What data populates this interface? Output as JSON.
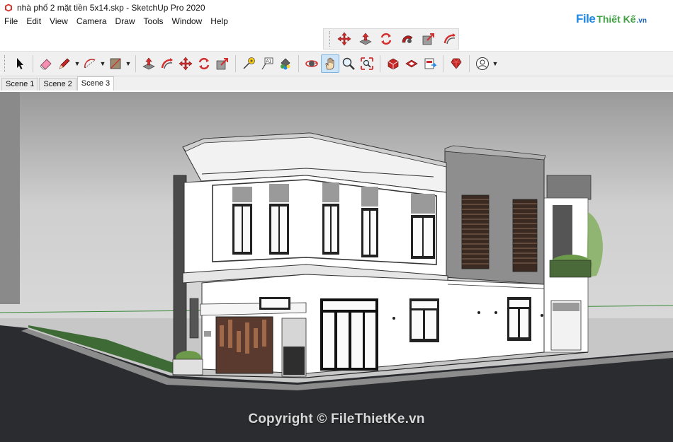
{
  "window": {
    "title": "nhà phố 2 mặt tiền 5x14.skp - SketchUp Pro 2020",
    "app_icon": "sketchup-icon"
  },
  "menu": [
    "File",
    "Edit",
    "View",
    "Camera",
    "Draw",
    "Tools",
    "Window",
    "Help"
  ],
  "logo": {
    "file": "File",
    "rest": "Thiết Kế",
    "vn": ".vn"
  },
  "float_toolbar": {
    "icons": [
      "move-icon",
      "push-pull-icon",
      "rotate-icon",
      "follow-me-icon",
      "scale-icon",
      "offset-icon"
    ]
  },
  "toolbar": {
    "icons": [
      "select-icon",
      "eraser-icon",
      "pencil-icon",
      "arc-icon",
      "rectangle-icon",
      "push-pull-icon",
      "offset-icon",
      "move-icon",
      "rotate-icon",
      "scale-icon",
      "tape-measure-icon",
      "text-icon",
      "paint-bucket-icon",
      "orbit-icon",
      "pan-icon",
      "zoom-icon",
      "zoom-extents-icon",
      "3d-warehouse-icon",
      "extension-warehouse-icon",
      "layout-icon",
      "ruby-icon",
      "account-icon"
    ],
    "active": "pan-icon"
  },
  "scenes": [
    "Scene 1",
    "Scene 2",
    "Scene 3"
  ],
  "active_scene": "Scene 3",
  "viewport": {
    "watermark": "Copyright © FileThietKe.vn",
    "sky_color": "#c8c8c8",
    "ground_color": "#2b2c30",
    "grass_color": "#4a7a3e",
    "wall_color": "#ffffff",
    "accent_wall_color": "#8e8e8e"
  }
}
